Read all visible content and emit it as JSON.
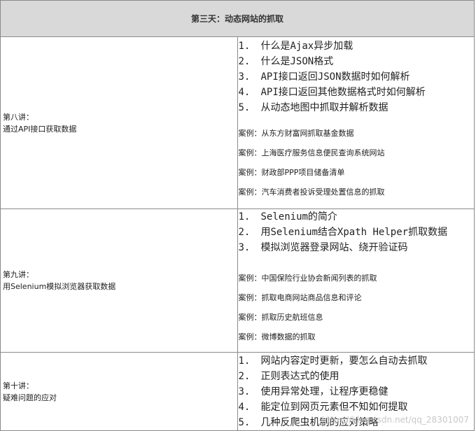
{
  "header": {
    "title": "第三天：动态网站的抓取"
  },
  "lessons": [
    {
      "title_line1": "第八讲：",
      "title_line2": "通过API接口获取数据",
      "topics": [
        "什么是Ajax异步加载",
        "什么是JSON格式",
        "API接口返回JSON数据时如何解析",
        "API接口返回其他数据格式时如何解析",
        "从动态地图中抓取并解析数据"
      ],
      "cases": [
        "案例：从东方财富网抓取基金数据",
        "案例：上海医疗服务信息便民查询系统网站",
        "案例：财政部PPP项目储备清单",
        "案例：汽车消费者投诉受理处置信息的抓取"
      ]
    },
    {
      "title_line1": "第九讲：",
      "title_line2": "用Selenium模拟浏览器获取数据",
      "topics": [
        "Selenium的简介",
        "用Selenium结合Xpath Helper抓取数据",
        "模拟浏览器登录网站、绕开验证码"
      ],
      "cases": [
        "案例：中国保险行业协会新闻列表的抓取",
        "案例：抓取电商网站商品信息和评论",
        "案例：抓取历史航班信息",
        "案例：微博数据的抓取"
      ]
    },
    {
      "title_line1": "第十讲：",
      "title_line2": "疑难问题的应对",
      "topics": [
        "网站内容定时更新，要怎么自动去抓取",
        "正则表达式的使用",
        "使用异常处理，让程序更稳健",
        "能定位到网页元素但不知如何提取",
        "几种反爬虫机制的应对策略"
      ],
      "cases": []
    }
  ],
  "watermark": "https://blog.csdn.net/qq_28301007"
}
